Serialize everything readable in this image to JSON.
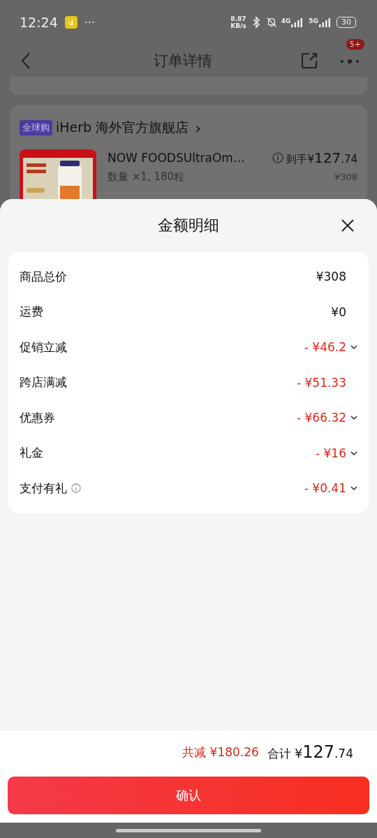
{
  "status_bar": {
    "time": "12:24",
    "more": "···",
    "net_speed": "8.87",
    "net_unit": "KB/s",
    "sim1": "4G",
    "sim2": "5G",
    "battery": "30"
  },
  "header": {
    "title": "订单详情",
    "badge": "5+"
  },
  "store": {
    "tag": "全球购",
    "name": "iHerb 海外官方旗舰店",
    "chevron": "›"
  },
  "product": {
    "name": "NOW FOODSUltraOm…",
    "spec": "数量 ×1, 180粒",
    "price_prefix": "到手¥",
    "price_integer": "127",
    "price_decimal": ".74",
    "original_price": "¥308"
  },
  "sheet": {
    "title": "金额明细",
    "rows": [
      {
        "label": "商品总价",
        "amount": "¥308",
        "kind": "plain",
        "expandable": false,
        "info": false
      },
      {
        "label": "运费",
        "amount": "¥0",
        "kind": "plain",
        "expandable": false,
        "info": false
      },
      {
        "label": "促销立减",
        "amount": "- ¥46.2",
        "kind": "discount",
        "expandable": true,
        "info": false
      },
      {
        "label": "跨店满减",
        "amount": "- ¥51.33",
        "kind": "discount",
        "expandable": false,
        "info": false
      },
      {
        "label": "优惠券",
        "amount": "- ¥66.32",
        "kind": "discount",
        "expandable": true,
        "info": false
      },
      {
        "label": "礼金",
        "amount": "- ¥16",
        "kind": "discount",
        "expandable": true,
        "info": false
      },
      {
        "label": "支付有礼",
        "amount": "- ¥0.41",
        "kind": "discount",
        "expandable": true,
        "info": true
      }
    ],
    "saving_label": "共减",
    "saving_amount": "¥180.26",
    "total_label": "合计",
    "total_prefix": "¥",
    "total_integer": "127",
    "total_decimal": ".74",
    "confirm": "确认"
  }
}
